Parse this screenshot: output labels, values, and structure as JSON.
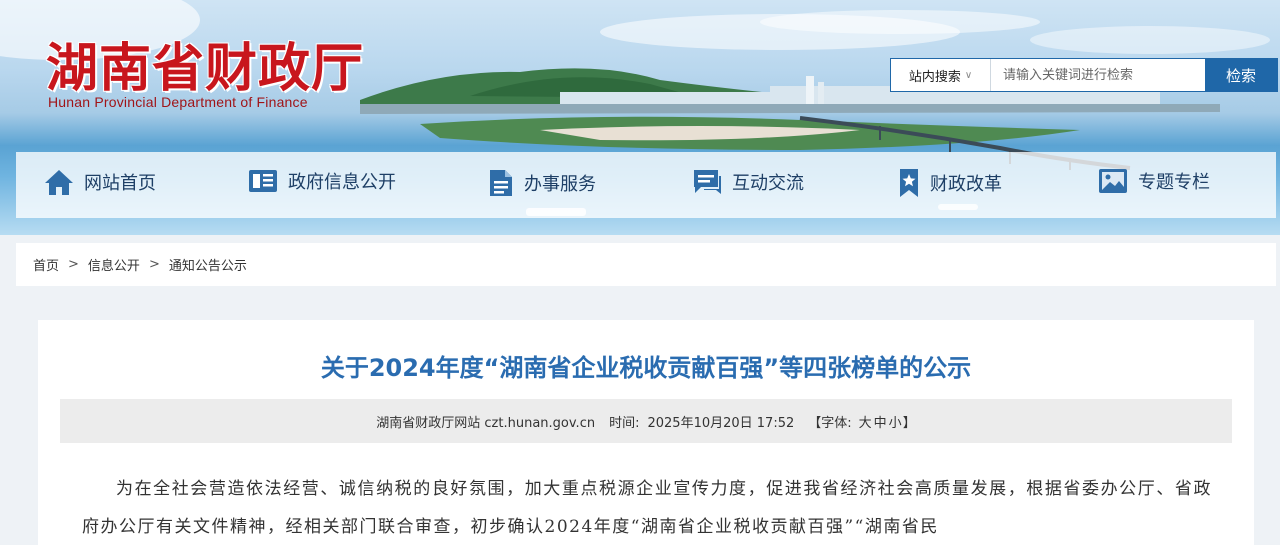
{
  "header": {
    "logo_cn": "湖南省财政厅",
    "logo_en": "Hunan Provincial Department of Finance"
  },
  "search": {
    "scope_label": "站内搜索",
    "scope_chevron": "∨",
    "placeholder": "请输入关键词进行检索",
    "button_label": "检索"
  },
  "nav": {
    "items": [
      {
        "label": "网站首页",
        "icon": "home-icon"
      },
      {
        "label": "政府信息公开",
        "icon": "newspaper-icon"
      },
      {
        "label": "办事服务",
        "icon": "document-icon"
      },
      {
        "label": "互动交流",
        "icon": "chat-icon"
      },
      {
        "label": "财政改革",
        "icon": "bookmark-star-icon"
      },
      {
        "label": "专题专栏",
        "icon": "image-icon"
      }
    ]
  },
  "breadcrumb": {
    "items": [
      "首页",
      "信息公开",
      "通知公告公示"
    ],
    "separator": ">"
  },
  "article": {
    "title": "关于2024年度“湖南省企业税收贡献百强”等四张榜单的公示",
    "source": "湖南省财政厅网站 czt.hunan.gov.cn",
    "time_label": "时间:",
    "time_value": "2025年10月20日 17:52",
    "font_open": "【字体:",
    "font_large": "大",
    "font_medium": "中",
    "font_small": "小",
    "font_close": "】",
    "body": "为在全社会营造依法经营、诚信纳税的良好氛围，加大重点税源企业宣传力度，促进我省经济社会高质量发展，根据省委办公厅、省政府办公厅有关文件精神，经相关部门联合审查，初步确认2024年度“湖南省企业税收贡献百强”“湖南省民"
  },
  "colors": {
    "brand_red": "#c8161d",
    "nav_text": "#1e3f66",
    "title_blue": "#2a6cb0",
    "search_blue": "#1f67a8"
  }
}
